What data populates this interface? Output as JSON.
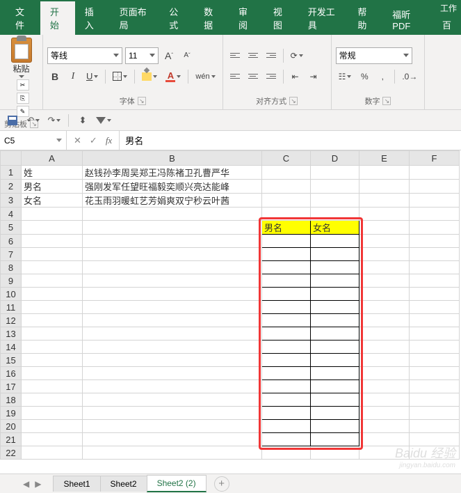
{
  "title_bar": {
    "title": "工作"
  },
  "tabs": {
    "file": "文件",
    "home": "开始",
    "insert": "插入",
    "layout": "页面布局",
    "formula": "公式",
    "data": "数据",
    "review": "审阅",
    "view": "视图",
    "dev": "开发工具",
    "help": "帮助",
    "foxit": "福昕PDF",
    "baidu": "百"
  },
  "ribbon": {
    "clipboard": {
      "paste": "粘贴",
      "group": "剪贴板"
    },
    "font": {
      "name": "等线",
      "size": "11",
      "increase": "A",
      "decrease": "A",
      "bold": "B",
      "italic": "I",
      "underline": "U",
      "fontcolor": "A",
      "wen": "wén",
      "group": "字体"
    },
    "align": {
      "group": "对齐方式"
    },
    "number": {
      "format": "常规",
      "percent": "%",
      "comma": ",",
      "group": "数字"
    }
  },
  "namebox": "C5",
  "formula": "男名",
  "columns": [
    "A",
    "B",
    "C",
    "D",
    "E",
    "F"
  ],
  "rows_data": [
    {
      "row": 1,
      "A": "姓",
      "B": "赵钱孙李周吴郑王冯陈褚卫孔曹严华"
    },
    {
      "row": 2,
      "A": "男名",
      "B": "强刚发军任望旺福毅奕顺兴亮达能峰"
    },
    {
      "row": 3,
      "A": "女名",
      "B": "花玉雨羽暖虹艺芳娟爽双宁秒云叶茜"
    }
  ],
  "table_headers": {
    "C5": "男名",
    "D5": "女名"
  },
  "sheets": {
    "s1": "Sheet1",
    "s2": "Sheet2",
    "s3": "Sheet2 (2)"
  },
  "watermark": {
    "main": "Baidu 经验",
    "sub": "jingyan.baidu.com"
  }
}
